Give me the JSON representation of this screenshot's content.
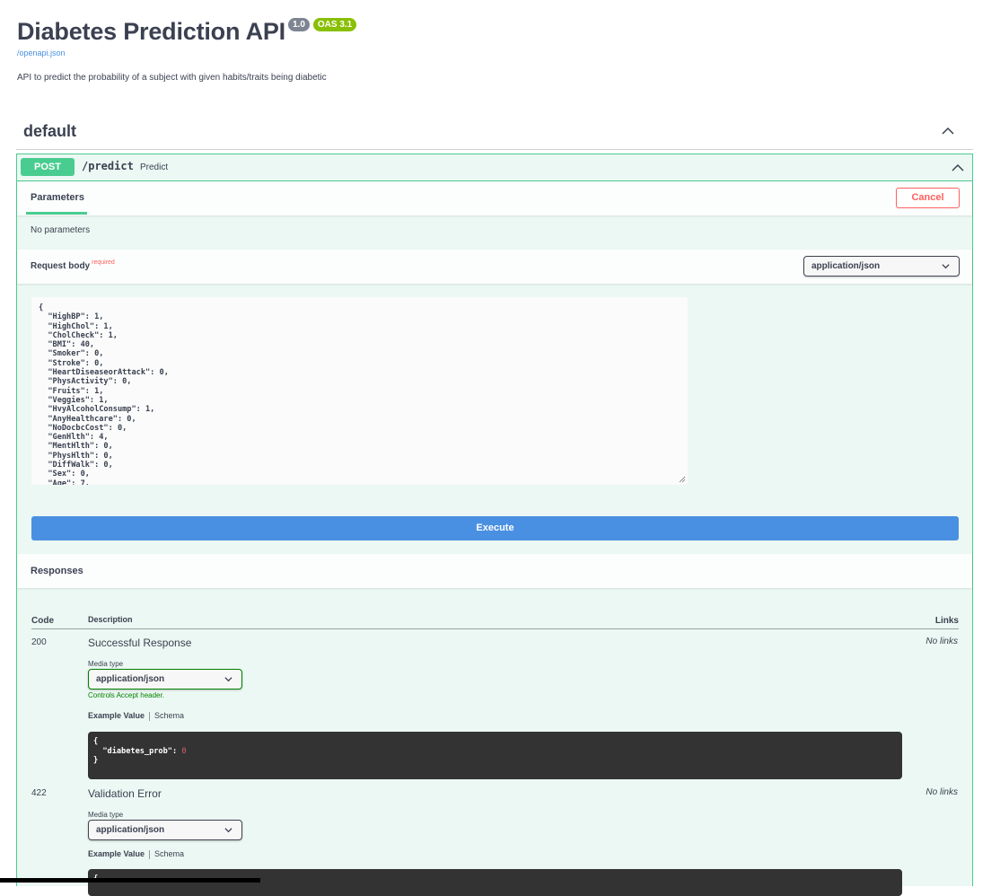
{
  "header": {
    "title": "Diabetes Prediction API",
    "version_badge": "1.0",
    "oas_badge": "OAS 3.1",
    "openapi_link": "/openapi.json",
    "description": "API to predict the probability of a subject with given habits/traits being diabetic"
  },
  "tag": {
    "name": "default"
  },
  "operation": {
    "method": "POST",
    "path": "/predict",
    "summary": "Predict",
    "parameters_tab": "Parameters",
    "cancel_label": "Cancel",
    "no_parameters": "No parameters",
    "request_body_label": "Request body",
    "required_label": "required",
    "content_type": "application/json",
    "request_body_text": "{\n  \"HighBP\": 1,\n  \"HighChol\": 1,\n  \"CholCheck\": 1,\n  \"BMI\": 40,\n  \"Smoker\": 0,\n  \"Stroke\": 0,\n  \"HeartDiseaseorAttack\": 0,\n  \"PhysActivity\": 0,\n  \"Fruits\": 1,\n  \"Veggies\": 1,\n  \"HvyAlcoholConsump\": 1,\n  \"AnyHealthcare\": 0,\n  \"NoDocbcCost\": 0,\n  \"GenHlth\": 4,\n  \"MentHlth\": 0,\n  \"PhysHlth\": 0,\n  \"DiffWalk\": 0,\n  \"Sex\": 0,\n  \"Age\": 7,",
    "execute_label": "Execute"
  },
  "responses": {
    "title": "Responses",
    "columns": {
      "code": "Code",
      "description": "Description",
      "links": "Links"
    },
    "items": [
      {
        "code": "200",
        "description": "Successful Response",
        "links": "No links",
        "media_type_label": "Media type",
        "media_type": "application/json",
        "controls_note": "Controls Accept header.",
        "example_tab": "Example Value",
        "schema_tab": "Schema",
        "example_open": "{",
        "example_key": "  \"diabetes_prob\": ",
        "example_value": "0",
        "example_close": "}"
      },
      {
        "code": "422",
        "description": "Validation Error",
        "links": "No links",
        "media_type_label": "Media type",
        "media_type": "application/json",
        "example_tab": "Example Value",
        "schema_tab": "Schema",
        "example_open": "{"
      }
    ]
  },
  "colors": {
    "post": "#49cc90",
    "execute": "#4990e2",
    "cancel": "#ff6060",
    "oas": "#89bf04"
  }
}
